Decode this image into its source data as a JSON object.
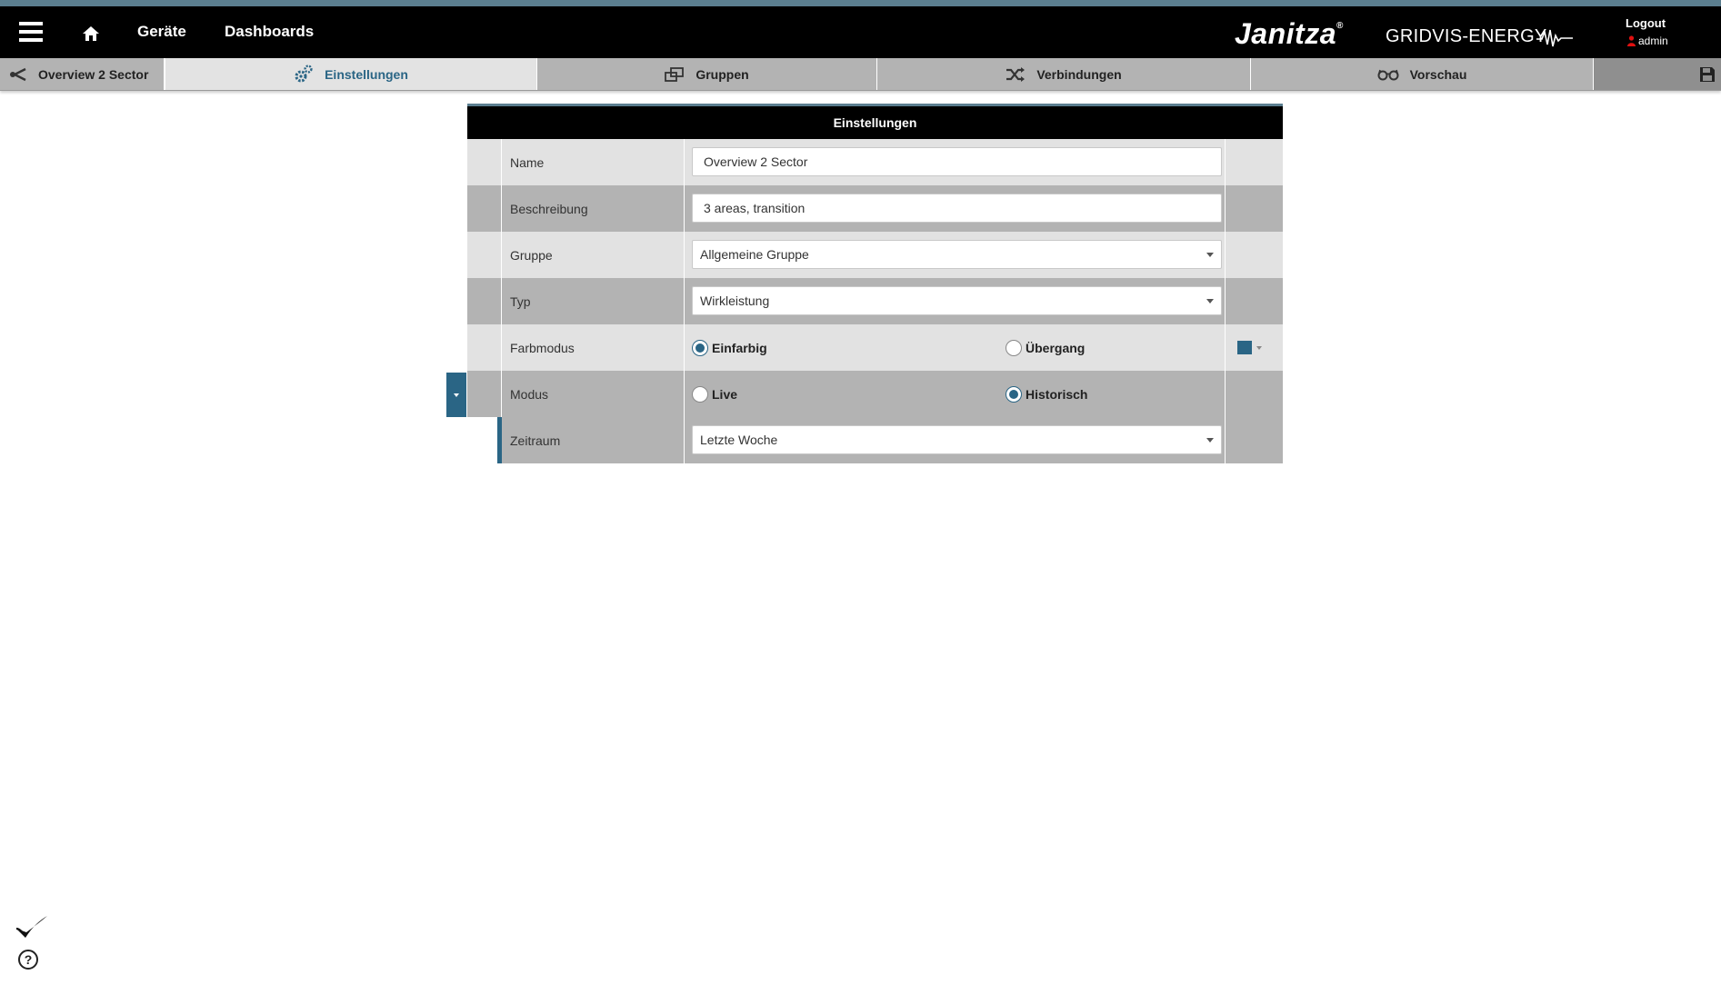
{
  "topbar": {
    "nav_geraete": "Geräte",
    "nav_dashboards": "Dashboards",
    "brand": "Janitza",
    "brand_mark": "®",
    "product": "GRIDVIS-ENERGY",
    "logout": "Logout",
    "user": "admin"
  },
  "tabs": {
    "back": "Overview 2 Sector",
    "einstellungen": "Einstellungen",
    "gruppen": "Gruppen",
    "verbindungen": "Verbindungen",
    "vorschau": "Vorschau"
  },
  "panel": {
    "title": "Einstellungen",
    "name": {
      "label": "Name",
      "value": "Overview 2 Sector"
    },
    "beschreibung": {
      "label": "Beschreibung",
      "value": "3 areas, transition"
    },
    "gruppe": {
      "label": "Gruppe",
      "value": "Allgemeine Gruppe"
    },
    "typ": {
      "label": "Typ",
      "value": "Wirkleistung"
    },
    "farbmodus": {
      "label": "Farbmodus",
      "option1": "Einfarbig",
      "option2": "Übergang",
      "selected": "Einfarbig",
      "color": "#2a6585"
    },
    "modus": {
      "label": "Modus",
      "option1": "Live",
      "option2": "Historisch",
      "selected": "Historisch"
    },
    "zeitraum": {
      "label": "Zeitraum",
      "value": "Letzte Woche"
    }
  },
  "colors": {
    "accent": "#2a6585",
    "topbar_bg": "#000000",
    "tab_bg": "#b3b3b3",
    "tab_active_bg": "#e3e3e3"
  }
}
